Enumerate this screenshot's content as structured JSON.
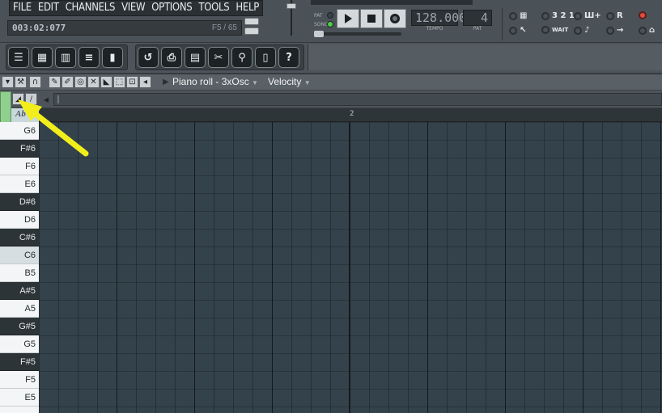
{
  "menu": [
    "FILE",
    "EDIT",
    "CHANNELS",
    "VIEW",
    "OPTIONS",
    "TOOLS",
    "HELP"
  ],
  "hint_bar": {
    "time": "003:02:077",
    "right": "F5 / 65"
  },
  "transport": {
    "pat_label": "PAT",
    "song_label": "SONG",
    "play_icon": "play-icon",
    "stop_icon": "stop-icon",
    "record_icon": "record-icon",
    "tempo_value": "128.000",
    "tempo_label": "TEMPO",
    "pattern_value": "4",
    "pattern_label": "PAT"
  },
  "options": [
    {
      "icon": "typing-keyboard-icon",
      "text": "▦"
    },
    {
      "icon": "countdown-icon",
      "text": "3 2 1"
    },
    {
      "icon": "blend-notes-icon",
      "text": "Ш+"
    },
    {
      "icon": "record-mode-icon",
      "text": "R"
    },
    {
      "icon": "record-button-icon",
      "text": ""
    },
    {
      "icon": "metronome-icon",
      "text": "↖"
    },
    {
      "icon": "wait-for-input-icon",
      "text": "WAIT"
    },
    {
      "icon": "step-edit-icon",
      "text": "♪"
    },
    {
      "icon": "loop-record-icon",
      "text": "→"
    },
    {
      "icon": "lock-icon",
      "text": "⌂"
    }
  ],
  "toolbar_a": [
    {
      "name": "playlist-window-button",
      "glyph": "☰"
    },
    {
      "name": "step-sequencer-button",
      "glyph": "▦"
    },
    {
      "name": "piano-roll-window-button",
      "glyph": "▥"
    },
    {
      "name": "channel-list-button",
      "glyph": "≡"
    },
    {
      "name": "mixer-window-button",
      "glyph": "▮"
    }
  ],
  "toolbar_b": [
    {
      "name": "undo-button",
      "glyph": "↺"
    },
    {
      "name": "save-button",
      "glyph": "⎙"
    },
    {
      "name": "project-browser-button",
      "glyph": "▤"
    },
    {
      "name": "cut-tool-button",
      "glyph": "✂"
    },
    {
      "name": "search-button",
      "glyph": "⚲"
    },
    {
      "name": "template-button",
      "glyph": "▯"
    },
    {
      "name": "help-button",
      "glyph": "?"
    }
  ],
  "piano_roll": {
    "title": "Piano roll - 3xOsc",
    "param": "Velocity",
    "ruler_bar": "2",
    "keys_corner": "Ab",
    "keys": [
      {
        "label": "G6",
        "color": "white"
      },
      {
        "label": "F#6",
        "color": "black"
      },
      {
        "label": "F6",
        "color": "white"
      },
      {
        "label": "E6",
        "color": "white"
      },
      {
        "label": "D#6",
        "color": "black"
      },
      {
        "label": "D6",
        "color": "white"
      },
      {
        "label": "C#6",
        "color": "black"
      },
      {
        "label": "C6",
        "color": "cnote"
      },
      {
        "label": "B5",
        "color": "white"
      },
      {
        "label": "A#5",
        "color": "black"
      },
      {
        "label": "A5",
        "color": "white"
      },
      {
        "label": "G#5",
        "color": "black"
      },
      {
        "label": "G5",
        "color": "white"
      },
      {
        "label": "F#5",
        "color": "black"
      },
      {
        "label": "F5",
        "color": "white"
      },
      {
        "label": "E5",
        "color": "white"
      },
      {
        "label": "",
        "color": "white"
      }
    ]
  },
  "colors": {
    "grid": "#34424c",
    "highlight_arrow": "#f2ee1c",
    "accent_green": "#8fd08e"
  }
}
